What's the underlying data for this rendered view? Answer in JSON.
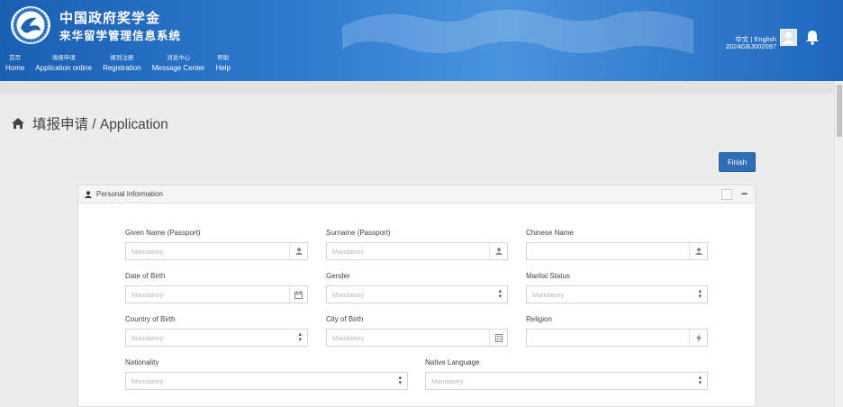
{
  "header": {
    "title_cn": "中国政府奖学金",
    "subtitle_cn": "来华留学管理信息系统",
    "lang_switch": "中文 | English",
    "user_id": "2024GBJ002097"
  },
  "nav": [
    {
      "cn": "首页",
      "en": "Home"
    },
    {
      "cn": "填报申请",
      "en": "Application online"
    },
    {
      "cn": "报到注册",
      "en": "Registration"
    },
    {
      "cn": "消息中心",
      "en": "Message Center"
    },
    {
      "cn": "帮助",
      "en": "Help"
    }
  ],
  "page": {
    "title": "填报申请 / Application",
    "finish_label": "Finish"
  },
  "panel": {
    "title": "Personal Information",
    "collapse": "−"
  },
  "fields": {
    "given_name": {
      "label": "Given Name (Passport)",
      "placeholder": "Mandatory"
    },
    "surname": {
      "label": "Surname (Passport)",
      "placeholder": "Mandatory"
    },
    "chinese_name": {
      "label": "Chinese Name",
      "placeholder": ""
    },
    "dob": {
      "label": "Date of Birth",
      "placeholder": "Mandatory"
    },
    "gender": {
      "label": "Gender",
      "placeholder": "Mandatory"
    },
    "marital": {
      "label": "Marital Status",
      "placeholder": "Mandatory"
    },
    "country_birth": {
      "label": "Country of Birth",
      "placeholder": "Mandatory"
    },
    "city_birth": {
      "label": "City of Birth",
      "placeholder": "Mandatory"
    },
    "religion": {
      "label": "Religion",
      "placeholder": ""
    },
    "nationality": {
      "label": "Nationality",
      "placeholder": "Mandatory"
    },
    "native_language": {
      "label": "Native Language",
      "placeholder": "Mandatory"
    }
  },
  "colors": {
    "header": "#1f66bf",
    "finish": "#2d6fb4"
  }
}
